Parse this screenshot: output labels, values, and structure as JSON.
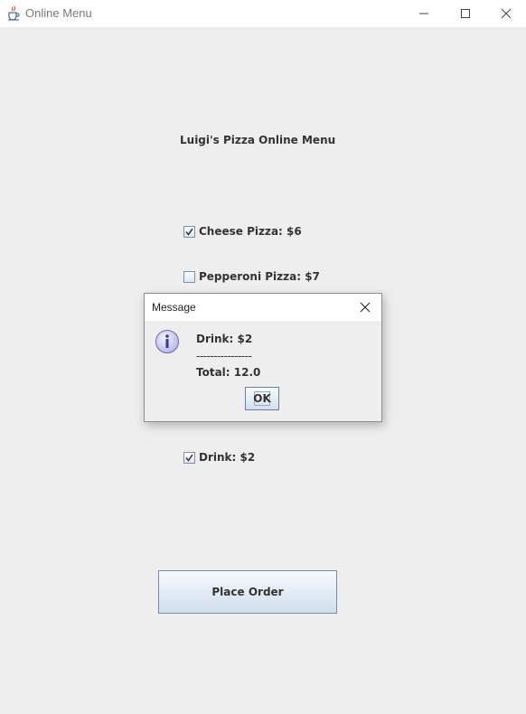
{
  "window": {
    "title": "Online Menu",
    "icon": "java-coffee-cup-icon",
    "controls": [
      "minimize-icon",
      "maximize-icon",
      "close-icon"
    ]
  },
  "menu": {
    "title": "Luigi's Pizza Online Menu",
    "items": [
      {
        "label": "Cheese Pizza: $6",
        "checked": true
      },
      {
        "label": "Pepperoni Pizza: $7",
        "checked": false
      },
      {
        "label": "Drink: $2",
        "checked": true
      }
    ],
    "place_order_label": "Place Order"
  },
  "dialog": {
    "title": "Message",
    "icon": "info-icon",
    "lines": [
      "Drink: $2",
      "----------------",
      "Total: 12.0"
    ],
    "ok_label": "OK"
  },
  "colors": {
    "background": "#eeeeee",
    "button_border": "#7a8aa3",
    "info_icon_fill": "#c9c9f0"
  }
}
